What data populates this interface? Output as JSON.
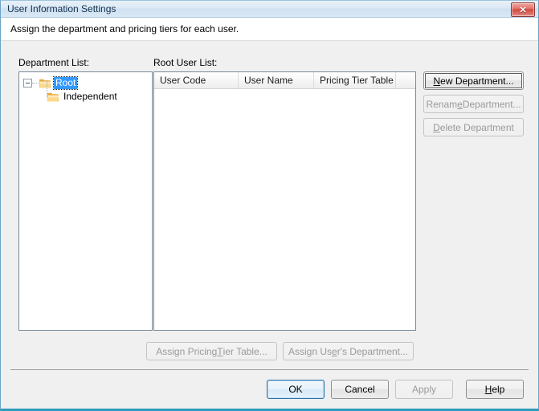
{
  "window": {
    "title": "User Information Settings",
    "close_icon": "close-icon",
    "close_glyph": "✕"
  },
  "header": {
    "description": "Assign the department and pricing tiers for each user."
  },
  "department_panel": {
    "label": "Department List:",
    "tree": {
      "root": {
        "label": "Root",
        "selected": true,
        "expanded": true,
        "icon": "folder-icon"
      },
      "children": [
        {
          "label": "Independent",
          "selected": false,
          "icon": "folder-icon"
        }
      ]
    }
  },
  "user_panel": {
    "label": "Root User List:",
    "columns": [
      {
        "label": "User Code"
      },
      {
        "label": "User Name"
      },
      {
        "label": "Pricing Tier Table"
      },
      {
        "label": ""
      }
    ],
    "rows": []
  },
  "department_actions": {
    "new": {
      "pre": "",
      "accel": "N",
      "post": "ew Department...",
      "enabled": true
    },
    "rename": {
      "pre": "Renam",
      "accel": "e",
      "post": " Department...",
      "enabled": false
    },
    "delete": {
      "pre": "",
      "accel": "D",
      "post": "elete Department",
      "enabled": false
    }
  },
  "assign_actions": {
    "pricing_tier": {
      "pre": "Assign Pricing ",
      "accel": "T",
      "post": "ier Table...",
      "enabled": false
    },
    "user_department": {
      "pre": "Assign Us",
      "accel": "e",
      "post": "r's Department...",
      "enabled": false
    }
  },
  "footer": {
    "ok": {
      "label": "OK",
      "enabled": true,
      "default": true
    },
    "cancel": {
      "label": "Cancel",
      "enabled": true
    },
    "apply": {
      "label": "Apply",
      "enabled": false
    },
    "help": {
      "pre": "",
      "accel": "H",
      "post": "elp",
      "enabled": true
    }
  },
  "colors": {
    "accent_border": "#2e9bbf",
    "selection": "#3399ff",
    "close_button": "#d44a40",
    "folder": "#f5c668",
    "dialog_bg": "#f0f0f0"
  }
}
